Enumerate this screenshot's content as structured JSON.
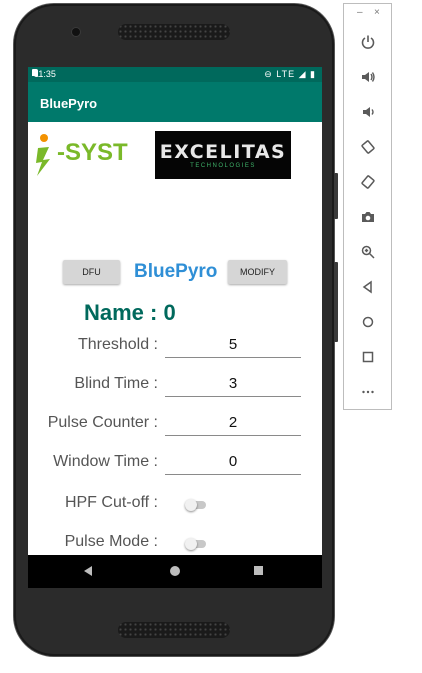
{
  "status_bar": {
    "time": "11:35",
    "network": "LTE"
  },
  "app_bar": {
    "title": "BluePyro"
  },
  "logos": {
    "isyst": "i-SYST",
    "excelitas_main": "EXCELITAS",
    "excelitas_sub": "TECHNOLOGIES"
  },
  "controls": {
    "dfu_label": "DFU",
    "brand_label": "BluePyro",
    "modify_label": "MODIFY"
  },
  "device": {
    "name_label": "Name : 0"
  },
  "fields": [
    {
      "label": "Threshold :",
      "value": "5"
    },
    {
      "label": "Blind Time :",
      "value": "3"
    },
    {
      "label": "Pulse Counter :",
      "value": "2"
    },
    {
      "label": "Window Time :",
      "value": "0"
    }
  ],
  "switches": [
    {
      "label": "HPF Cut-off :",
      "on": false
    },
    {
      "label": "Pulse Mode :",
      "on": false
    }
  ],
  "toolbar": {
    "minimize": "–",
    "close": "×",
    "buttons": [
      "power-icon",
      "volume-up-icon",
      "volume-down-icon",
      "rotate-left-icon",
      "rotate-right-icon",
      "camera-icon",
      "zoom-icon",
      "back-icon",
      "home-icon",
      "overview-icon",
      "more-icon"
    ]
  },
  "colors": {
    "app_bar": "#00796b",
    "status_bar": "#00695c",
    "brand": "#2f8fd6",
    "name": "#00695c"
  }
}
